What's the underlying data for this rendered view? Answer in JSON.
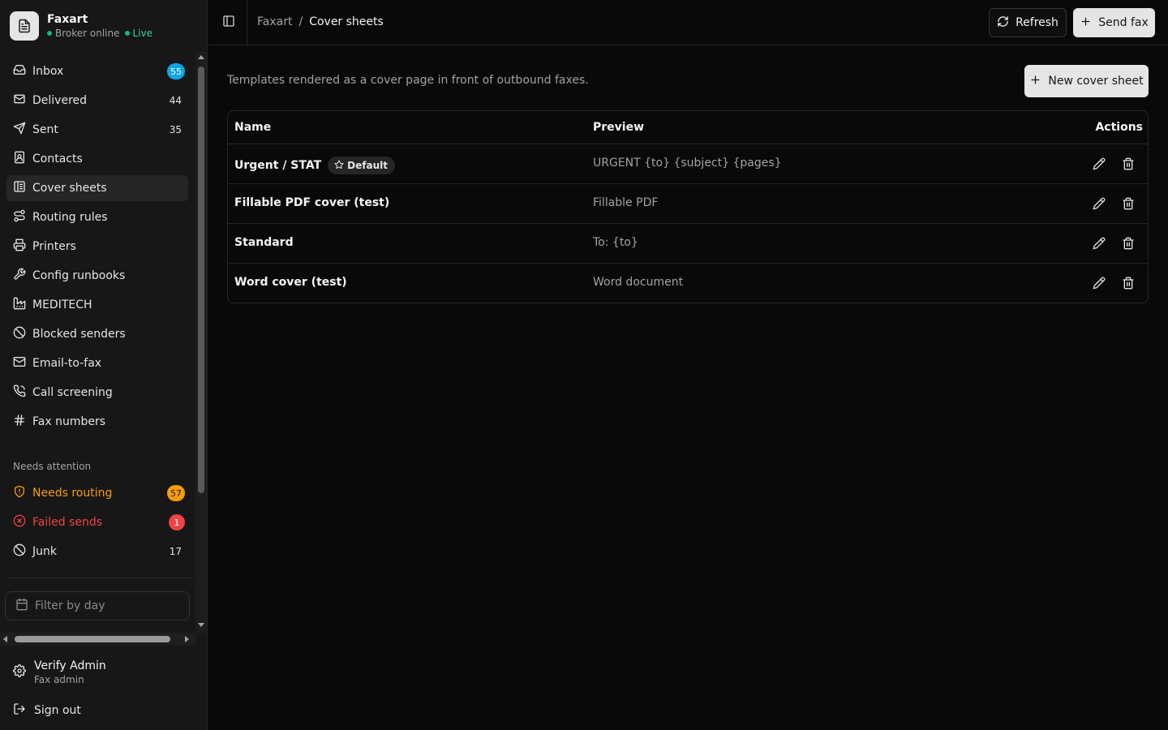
{
  "app": {
    "name": "Faxart",
    "broker_status": "Broker online",
    "live_label": "Live"
  },
  "sidebar": {
    "items": [
      {
        "label": "Inbox",
        "icon": "inbox-icon",
        "count": "55",
        "badge": "blue"
      },
      {
        "label": "Delivered",
        "icon": "mail-open-icon",
        "count": "44"
      },
      {
        "label": "Sent",
        "icon": "send-icon",
        "count": "35"
      },
      {
        "label": "Contacts",
        "icon": "contacts-icon"
      },
      {
        "label": "Cover sheets",
        "icon": "cover-sheet-icon",
        "active": true
      },
      {
        "label": "Routing rules",
        "icon": "route-icon"
      },
      {
        "label": "Printers",
        "icon": "printer-icon"
      },
      {
        "label": "Config runbooks",
        "icon": "wrench-icon"
      },
      {
        "label": "MEDITECH",
        "icon": "factory-icon"
      },
      {
        "label": "Blocked senders",
        "icon": "ban-icon"
      },
      {
        "label": "Email-to-fax",
        "icon": "mail-icon"
      },
      {
        "label": "Call screening",
        "icon": "phone-icon"
      },
      {
        "label": "Fax numbers",
        "icon": "hash-icon"
      }
    ],
    "attention_label": "Needs attention",
    "attention_items": [
      {
        "label": "Needs routing",
        "icon": "shield-alert-icon",
        "count": "57",
        "tone": "warning"
      },
      {
        "label": "Failed sends",
        "icon": "x-circle-icon",
        "count": "1",
        "tone": "error"
      },
      {
        "label": "Junk",
        "icon": "ban-icon",
        "count": "17"
      }
    ],
    "filter_placeholder": "Filter by day",
    "user": {
      "name": "Verify Admin",
      "role": "Fax admin"
    },
    "sign_out_label": "Sign out"
  },
  "header": {
    "breadcrumb_root": "Faxart",
    "breadcrumb_sep": "/",
    "breadcrumb_current": "Cover sheets",
    "refresh_label": "Refresh",
    "send_fax_label": "Send fax"
  },
  "main": {
    "description": "Templates rendered as a cover page in front of outbound faxes.",
    "new_button_label": "New cover sheet",
    "table": {
      "columns": {
        "name": "Name",
        "preview": "Preview",
        "actions": "Actions"
      },
      "rows": [
        {
          "name": "Urgent / STAT",
          "badge": "Default",
          "preview": "URGENT {to} {subject} {pages}"
        },
        {
          "name": "Fillable PDF cover (test)",
          "preview": "Fillable PDF"
        },
        {
          "name": "Standard",
          "preview": "To: {to}"
        },
        {
          "name": "Word cover (test)",
          "preview": "Word document"
        }
      ]
    }
  },
  "colors": {
    "background": "#090909",
    "sidebar": "#171717",
    "accent_blue": "#0ea5e9",
    "warning": "#f59e0b",
    "error": "#ef4444",
    "online": "#10b981"
  }
}
